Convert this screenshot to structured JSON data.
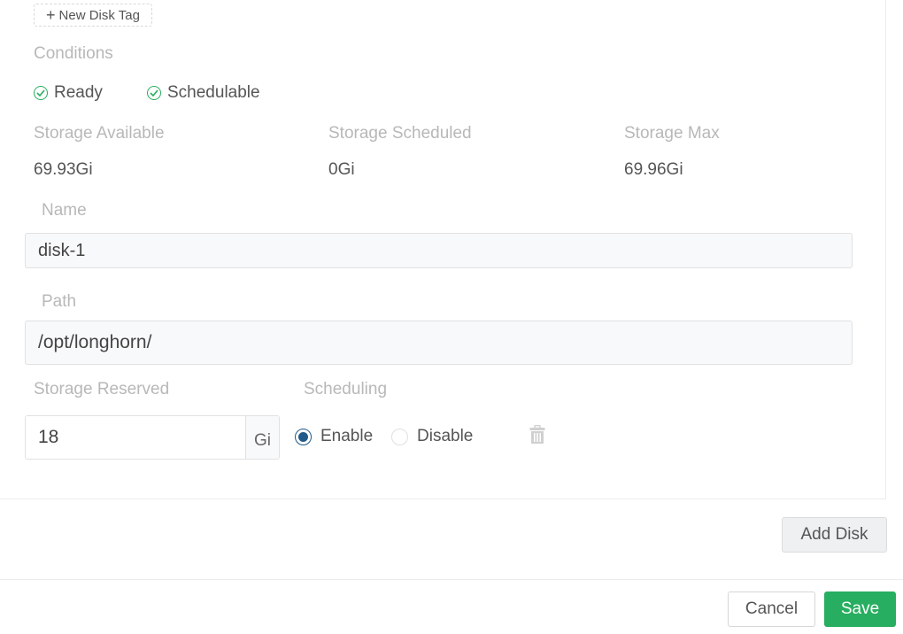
{
  "disk": {
    "new_tag_label": "New Disk Tag",
    "conditions_label": "Conditions",
    "conditions": [
      {
        "label": "Ready",
        "status": "ok"
      },
      {
        "label": "Schedulable",
        "status": "ok"
      }
    ],
    "stats": [
      {
        "label": "Storage Available",
        "value": "69.93Gi"
      },
      {
        "label": "Storage Scheduled",
        "value": "0Gi"
      },
      {
        "label": "Storage Max",
        "value": "69.96Gi"
      }
    ],
    "name_label": "Name",
    "name_value": "disk-1",
    "path_label": "Path",
    "path_value": "/opt/longhorn/",
    "reserved_label": "Storage Reserved",
    "reserved_value": "18",
    "reserved_unit": "Gi",
    "scheduling_label": "Scheduling",
    "scheduling_options": [
      {
        "label": "Enable",
        "selected": true
      },
      {
        "label": "Disable",
        "selected": false
      }
    ]
  },
  "actions": {
    "add_disk": "Add Disk",
    "cancel": "Cancel",
    "save": "Save"
  },
  "colors": {
    "accent_green": "#27ae60",
    "radio_blue": "#1f5a8a"
  }
}
